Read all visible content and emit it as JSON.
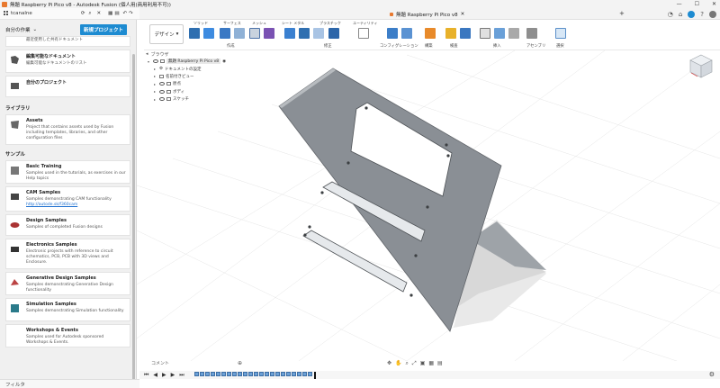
{
  "window": {
    "title": "無題 Raspberry Pi Pico v8 - Autodesk Fusion (個人用(商用利用不可))",
    "controls": [
      "—",
      "☐",
      "✕"
    ]
  },
  "left_header": {
    "user": "tcanalne",
    "nav_label": "ﾗ / ﾂ",
    "close_label": "閉じる"
  },
  "left_panel": {
    "project_selector": "自分の作業",
    "new_project_button": "新規プロジェクト",
    "recent_cards": [
      {
        "title": "",
        "desc": "最近使用した共有ドキュメント"
      },
      {
        "title": "編集可能なドキュメント",
        "desc": "編集可能なドキュメントのリスト"
      },
      {
        "title": "自分のプロジェクト",
        "desc": ""
      }
    ],
    "library_label": "ライブラリ",
    "library_cards": [
      {
        "title": "Assets",
        "desc": "Project that contains assets used by Fusion including templates, libraries, and other configuration files"
      }
    ],
    "samples_label": "サンプル",
    "sample_cards": [
      {
        "title": "Basic Training",
        "desc": "Samples used in the tutorials, as exercises in our Help topics"
      },
      {
        "title": "CAM Samples",
        "desc": "Samples demonstrating CAM functionality",
        "link": "http://autode.sk/f360cam"
      },
      {
        "title": "Design Samples",
        "desc": "Samples of completed Fusion designs"
      },
      {
        "title": "Electronics Samples",
        "desc": "Electronic projects with reference to circuit schematics, PCB, PCB with 3D views and Enclosure."
      },
      {
        "title": "Generative Design Samples",
        "desc": "Samples demonstrating Generative Design functionality"
      },
      {
        "title": "Simulation Samples",
        "desc": "Samples demonstrating Simulation functionality"
      },
      {
        "title": "Workshops & Events",
        "desc": "Samples used for Autodesk sponsored Workshops & Events."
      }
    ],
    "filter_label": "フィルタ"
  },
  "tabs": {
    "active_doc": "無題 Raspberry Pi Pico v8"
  },
  "ribbon": {
    "design_button": "デザイン",
    "tab_labels": [
      "ソリッド",
      "サーフェス",
      "メッシュ",
      "シート メタル",
      "プラスチック",
      "ユーティリティ"
    ],
    "groups": [
      "作成",
      "修正",
      "コンフィグレーション",
      "構築",
      "検査",
      "挿入",
      "アセンブリ",
      "選択"
    ]
  },
  "browser": {
    "header": "ブラウザ",
    "root": "無題 Raspberry Pi Pico v8",
    "items": [
      "ドキュメントの設定",
      "名前付きビュー",
      "原点",
      "ボディ",
      "スケッチ"
    ]
  },
  "comments_label": "コメント",
  "colors": {
    "accent": "#1d8bd1",
    "fusion_orange": "#e8792f",
    "plate": "#8a8f95"
  }
}
